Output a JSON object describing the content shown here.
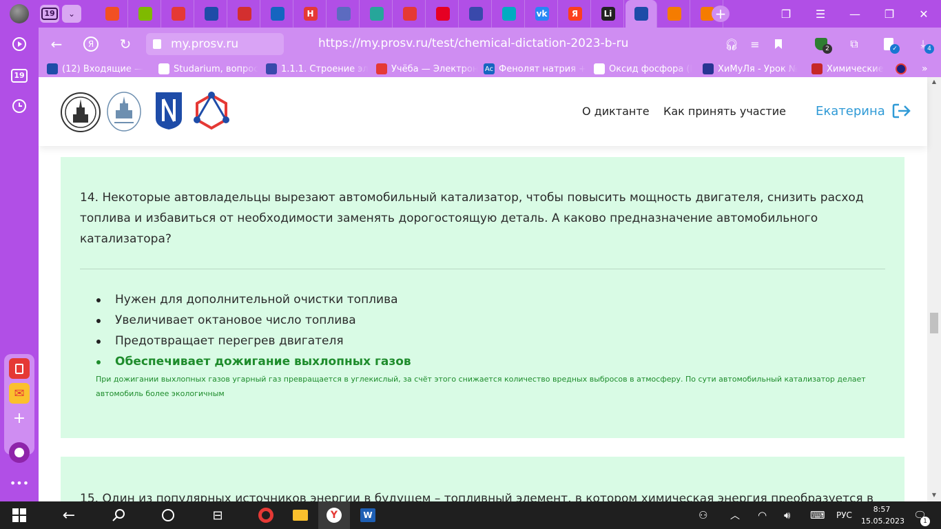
{
  "browser": {
    "tab_count": "19",
    "address_host": "my.prosv.ru",
    "url": "https://my.prosv.ru/test/chemical-dictation-2023-b-ru",
    "colors": {
      "chrome": "#b14fe6",
      "toolbar": "#cf8df2"
    },
    "tabs": [
      {
        "icon": "microsoft-icon",
        "color": "#f25022"
      },
      {
        "icon": "microsoft-icon",
        "color": "#7fba00"
      },
      {
        "icon": "doc-red-icon",
        "color": "#e53935"
      },
      {
        "icon": "shield-blue-icon",
        "color": "#1e4ca8"
      },
      {
        "icon": "youtube-mix-icon",
        "color": "#d32f2f"
      },
      {
        "icon": "swoosh-icon",
        "color": "#1565c0"
      },
      {
        "icon": "letter-h-icon",
        "color": "#e53935",
        "text": "Н"
      },
      {
        "icon": "globe-icon",
        "color": "#5c6bc0"
      },
      {
        "icon": "book-icon",
        "color": "#26a69a"
      },
      {
        "icon": "play-icon",
        "color": "#e53935"
      },
      {
        "icon": "pinterest-icon",
        "color": "#e60023"
      },
      {
        "icon": "pen-icon",
        "color": "#3949ab"
      },
      {
        "icon": "swirl-icon",
        "color": "#00acc1"
      },
      {
        "icon": "vk-icon",
        "color": "#2787f5",
        "text": "vk"
      },
      {
        "icon": "yandex-icon",
        "color": "#fc3f1d",
        "text": "Я"
      },
      {
        "icon": "li-icon",
        "color": "#212121",
        "text": "Li"
      },
      {
        "icon": "shield-blue-icon",
        "color": "#1e4ca8",
        "active": true
      },
      {
        "icon": "paper-plane-icon",
        "color": "#f57c00"
      },
      {
        "icon": "paper-plane-icon",
        "color": "#f57c00"
      }
    ],
    "bookmarks": [
      {
        "icon": "mail-icon",
        "color": "#1e4ca8",
        "label": "(12) Входящие — "
      },
      {
        "icon": "studarium-icon",
        "color": "#ffffff",
        "label": "Studarium, вопрос"
      },
      {
        "icon": "bird-icon",
        "color": "#3949ab",
        "label": "1.1.1. Строение эл"
      },
      {
        "icon": "doc-red-icon",
        "color": "#e53935",
        "label": "Учёба — Электрон"
      },
      {
        "icon": "ac-icon",
        "color": "#1565c0",
        "label": "Фенолят натрия +",
        "text": "Ac"
      },
      {
        "icon": "dots-icon",
        "color": "#ffffff",
        "label": "Оксид фосфора (I"
      },
      {
        "icon": "grid-icon",
        "color": "#283593",
        "label": "ХиМуЛя - Урок №"
      },
      {
        "icon": "flask-icon",
        "color": "#c62828",
        "label": "Химические"
      }
    ]
  },
  "sidebar": {
    "count": "19"
  },
  "site": {
    "nav": {
      "about": "О диктанте",
      "how_to": "Как принять участие",
      "user": "Екатерина"
    },
    "question14": {
      "text": "14. Некоторые автовладельцы вырезают автомобильный катализатор, чтобы повысить мощность двигателя, снизить расход топлива и избавиться от необходимости заменять дорогостоящую деталь. А каково предназначение автомобильного катализатора?",
      "options": [
        "Нужен для дополнительной очистки топлива",
        "Увеличивает октановое число топлива",
        "Предотвращает перегрев двигателя",
        "Обеспечивает дожигание выхлопных газов"
      ],
      "correct_index": 3,
      "explanation": "При дожигании выхлопных газов угарный газ превращается в углекислый, за счёт этого снижается количество вредных выбросов в атмосферу. По сути автомобильный катализатор делает автомобиль более экологичным"
    },
    "question15": {
      "text": "15. Один из популярных источников энергии в будущем – топливный элемент, в котором химическая энергия преобразуется в"
    },
    "colors": {
      "card_bg": "#d9fbe5",
      "correct": "#1e8c2c",
      "link": "#2f9ad6"
    }
  },
  "taskbar": {
    "language": "РУС",
    "time": "8:57",
    "date": "15.05.2023",
    "notifications": "1",
    "download_badge": "4",
    "ext_badge": "2"
  }
}
